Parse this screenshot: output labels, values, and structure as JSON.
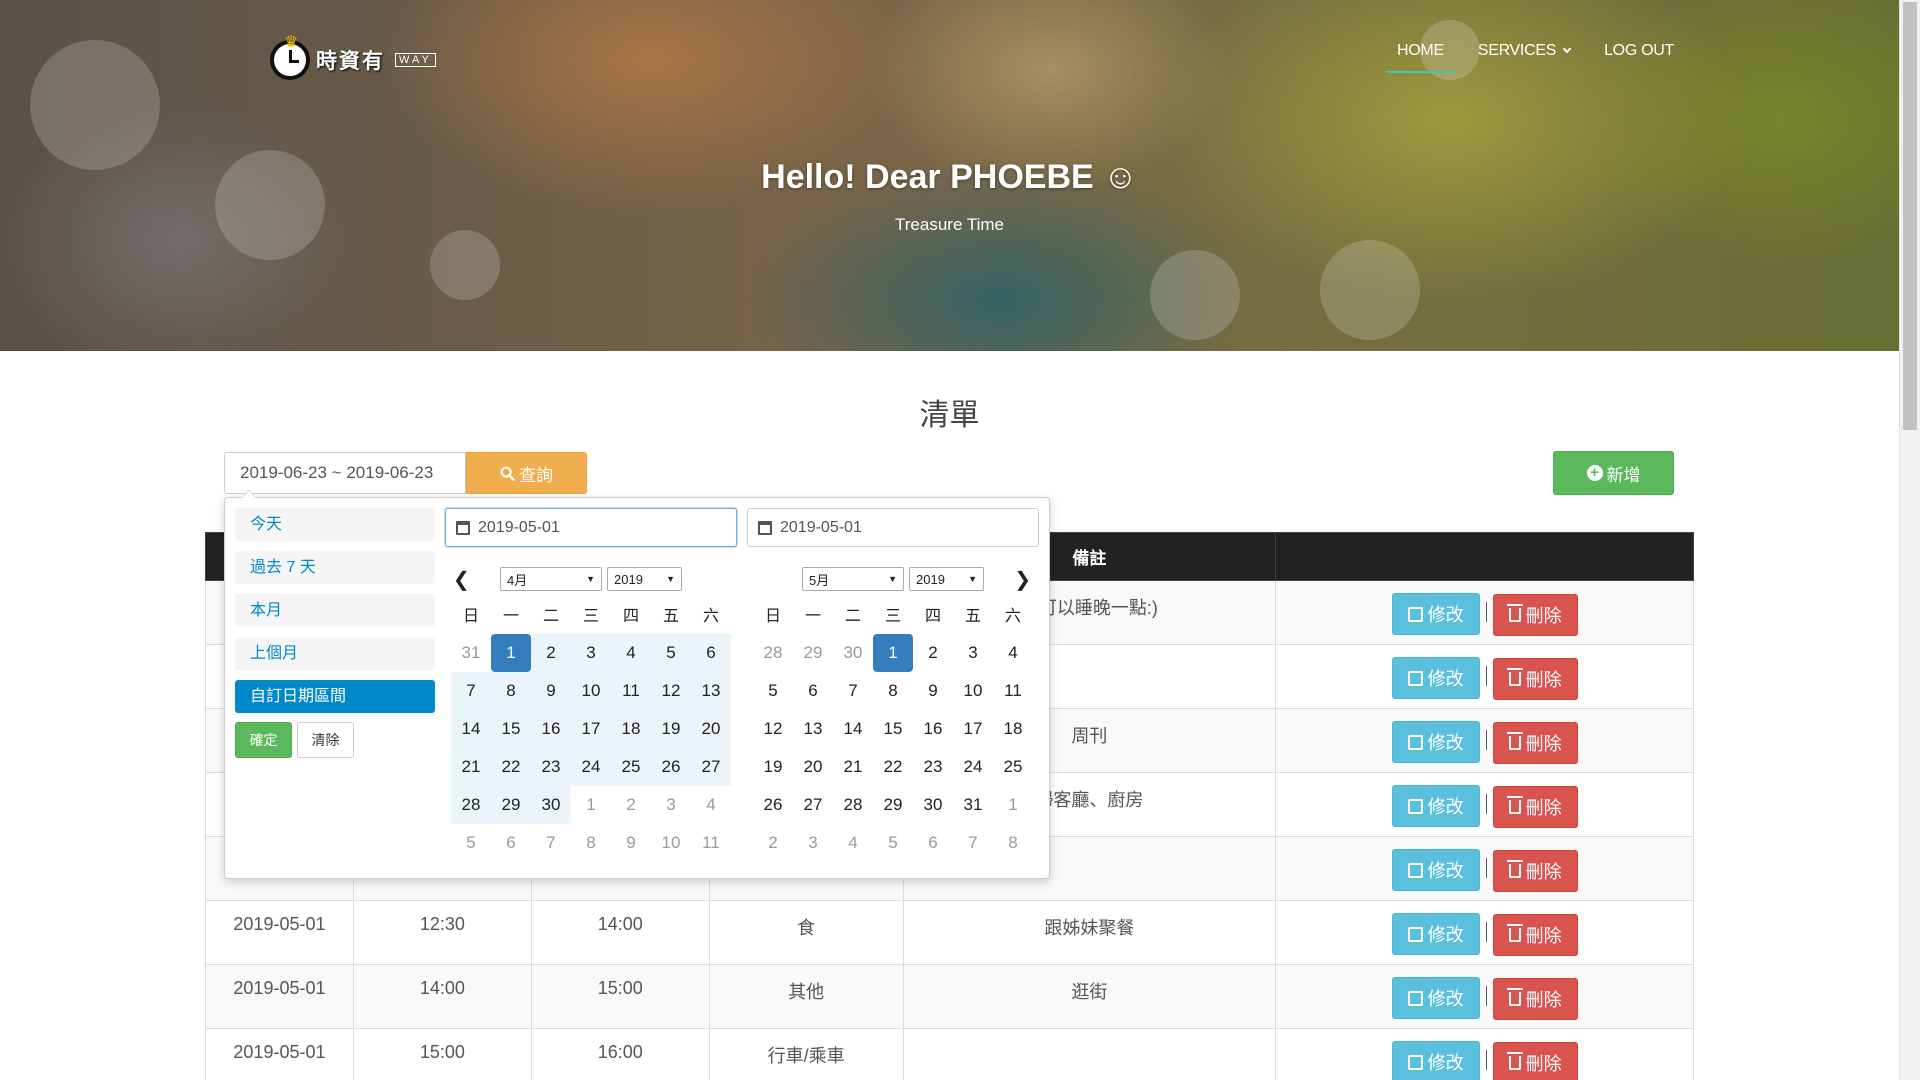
{
  "header": {
    "logo_text": "時資有",
    "logo_sub": "WAY",
    "nav": {
      "home": "HOME",
      "services": "SERVICES",
      "logout": "LOG OUT"
    },
    "greeting": "Hello! Dear PHOEBE ☺",
    "subtitle": "Treasure Time"
  },
  "main": {
    "title": "清單",
    "date_range_value": "2019-06-23 ~ 2019-06-23",
    "query_label": "查詢",
    "add_label": "新增"
  },
  "datepicker": {
    "ranges": [
      "今天",
      "過去 7 天",
      "本月",
      "上個月",
      "自訂日期區間"
    ],
    "active_range": "自訂日期區間",
    "apply_label": "確定",
    "clear_label": "清除",
    "left": {
      "input_value": "2019-05-01",
      "month": "4月",
      "year": "2019",
      "weekdays": [
        "日",
        "一",
        "二",
        "三",
        "四",
        "五",
        "六"
      ],
      "weeks": [
        [
          "31",
          "1",
          "2",
          "3",
          "4",
          "5",
          "6"
        ],
        [
          "7",
          "8",
          "9",
          "10",
          "11",
          "12",
          "13"
        ],
        [
          "14",
          "15",
          "16",
          "17",
          "18",
          "19",
          "20"
        ],
        [
          "21",
          "22",
          "23",
          "24",
          "25",
          "26",
          "27"
        ],
        [
          "28",
          "29",
          "30",
          "1",
          "2",
          "3",
          "4"
        ],
        [
          "5",
          "6",
          "7",
          "8",
          "9",
          "10",
          "11"
        ]
      ]
    },
    "right": {
      "input_value": "2019-05-01",
      "month": "5月",
      "year": "2019",
      "weekdays": [
        "日",
        "一",
        "二",
        "三",
        "四",
        "五",
        "六"
      ],
      "weeks": [
        [
          "28",
          "29",
          "30",
          "1",
          "2",
          "3",
          "4"
        ],
        [
          "5",
          "6",
          "7",
          "8",
          "9",
          "10",
          "11"
        ],
        [
          "12",
          "13",
          "14",
          "15",
          "16",
          "17",
          "18"
        ],
        [
          "19",
          "20",
          "21",
          "22",
          "23",
          "24",
          "25"
        ],
        [
          "26",
          "27",
          "28",
          "29",
          "30",
          "31",
          "1"
        ],
        [
          "2",
          "3",
          "4",
          "5",
          "6",
          "7",
          "8"
        ]
      ]
    }
  },
  "table": {
    "remark_header": "備註",
    "edit_label": "修改",
    "delete_label": "刪除",
    "rows": [
      {
        "date": "",
        "start": "",
        "end": "",
        "type": "",
        "remark": "節可以睡晚一點:)"
      },
      {
        "date": "",
        "start": "",
        "end": "",
        "type": "",
        "remark": ""
      },
      {
        "date": "",
        "start": "",
        "end": "",
        "type": "",
        "remark": "周刊"
      },
      {
        "date": "",
        "start": "",
        "end": "",
        "type": "",
        "remark": "掃客廳、廚房"
      },
      {
        "date": "",
        "start": "",
        "end": "",
        "type": "",
        "remark": ""
      },
      {
        "date": "2019-05-01",
        "start": "12:30",
        "end": "14:00",
        "type": "食",
        "remark": "跟姊妹聚餐"
      },
      {
        "date": "2019-05-01",
        "start": "14:00",
        "end": "15:00",
        "type": "其他",
        "remark": "逛街"
      },
      {
        "date": "2019-05-01",
        "start": "15:00",
        "end": "16:00",
        "type": "行車/乘車",
        "remark": ""
      }
    ]
  },
  "colors": {
    "nav_active_underline": "#3cc6b3",
    "query_button": "#f0ad4e",
    "add_button": "#5cb85c",
    "edit_button": "#5bc0de",
    "delete_button": "#d9534f",
    "selected_day": "#357ebd",
    "active_range": "#0088cc"
  },
  "icons": {
    "query": "search-icon",
    "add": "plus-circle-icon",
    "edit": "edit-icon",
    "delete": "trash-icon",
    "date_input": "calendar-icon"
  }
}
